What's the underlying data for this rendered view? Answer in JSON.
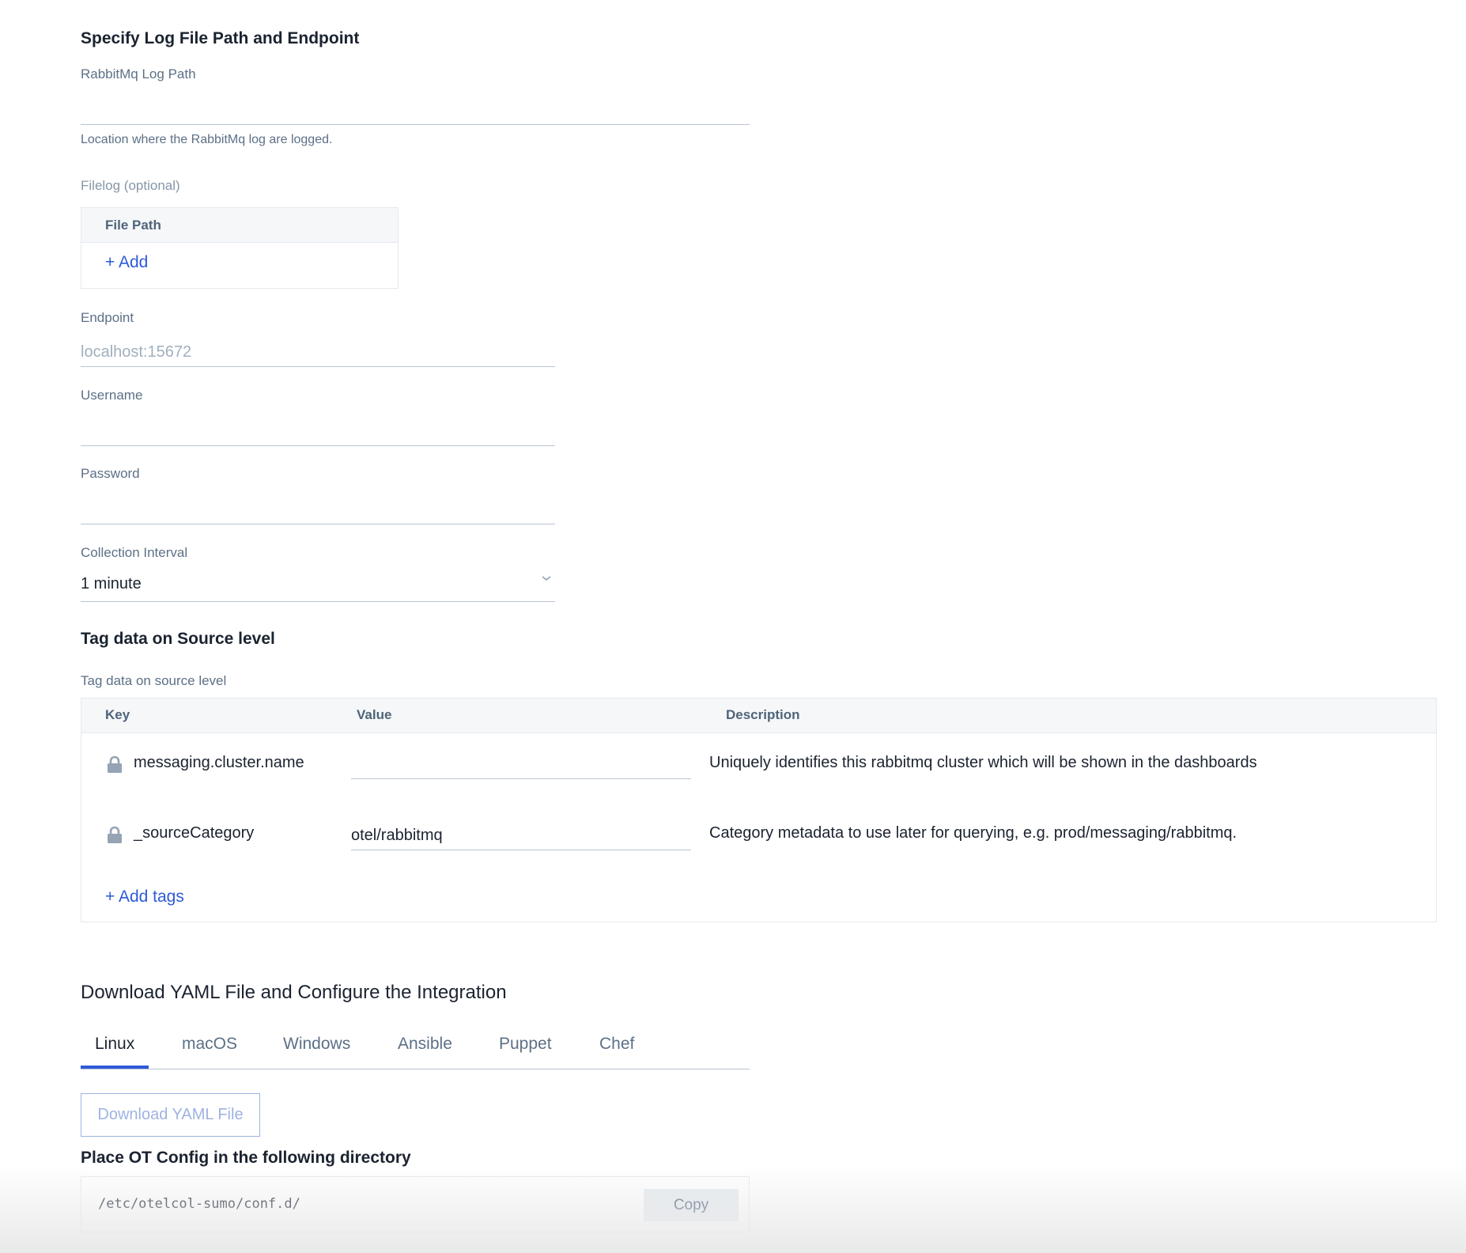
{
  "log_section": {
    "title": "Specify Log File Path and Endpoint",
    "log_path": {
      "label": "RabbitMq Log Path",
      "value": "",
      "help": "Location where the RabbitMq log are logged."
    },
    "filelog": {
      "label": "Filelog (optional)",
      "column_header": "File Path",
      "add_label": "+ Add"
    },
    "endpoint": {
      "label": "Endpoint",
      "value": "",
      "placeholder": "localhost:15672"
    },
    "username": {
      "label": "Username",
      "value": ""
    },
    "password": {
      "label": "Password",
      "value": ""
    },
    "collection_interval": {
      "label": "Collection Interval",
      "selected": "1 minute"
    }
  },
  "tag_section": {
    "title": "Tag data on Source level",
    "subtitle": "Tag data on source level",
    "columns": [
      "Key",
      "Value",
      "Description"
    ],
    "rows": [
      {
        "key": "messaging.cluster.name",
        "value": "",
        "description": "Uniquely identifies this rabbitmq cluster which will be shown in the dashboards",
        "locked": true
      },
      {
        "key": "_sourceCategory",
        "value": "otel/rabbitmq",
        "description": "Category metadata to use later for querying, e.g. prod/messaging/rabbitmq.",
        "locked": true
      }
    ],
    "add_tags_label": "+ Add tags"
  },
  "download_section": {
    "title": "Download YAML File and Configure the Integration",
    "tabs": [
      "Linux",
      "macOS",
      "Windows",
      "Ansible",
      "Puppet",
      "Chef"
    ],
    "active_tab": "Linux",
    "download_button": "Download YAML File",
    "config_title": "Place OT Config in the following directory",
    "config_path": "/etc/otelcol-sumo/conf.d/",
    "copy_button": "Copy"
  },
  "colors": {
    "accent": "#2d5ad8",
    "label": "#5c7086",
    "text": "#1b2330",
    "border": "#b9c4d1"
  }
}
